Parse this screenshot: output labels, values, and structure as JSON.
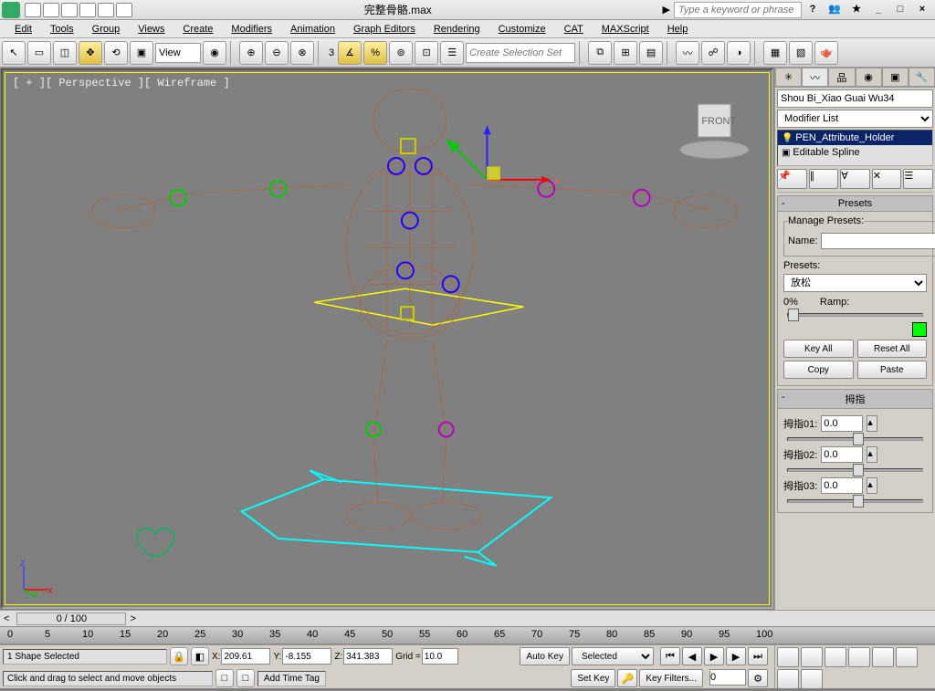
{
  "title": "完整骨骼.max",
  "search_placeholder": "Type a keyword or phrase",
  "menus": [
    "Edit",
    "Tools",
    "Group",
    "Views",
    "Create",
    "Modifiers",
    "Animation",
    "Graph Editors",
    "Rendering",
    "Customize",
    "CAT",
    "MAXScript",
    "Help"
  ],
  "view_label": "View",
  "selection_set_placeholder": "Create Selection Set",
  "viewport_label": "[ + ][ Perspective ][ Wireframe ]",
  "object_name": "Shou Bi_Xiao Guai Wu34",
  "modifier_list_label": "Modifier List",
  "mod_stack": {
    "item1": "PEN_Attribute_Holder",
    "item2": "Editable Spline"
  },
  "presets": {
    "title": "Presets",
    "manage": "Manage Presets:",
    "name_label": "Name:",
    "presets_label": "Presets:",
    "preset_value": "放松",
    "pct": "0%",
    "ramp": "Ramp:",
    "key_all": "Key All",
    "reset_all": "Reset All",
    "copy": "Copy",
    "paste": "Paste"
  },
  "thumb": {
    "title": "拇指",
    "r1": "拇指01:",
    "r2": "拇指02:",
    "r3": "拇指03:",
    "v": "0.0"
  },
  "time": {
    "cur": "0",
    "range": "/ 100"
  },
  "ruler_ticks": [
    "0",
    "5",
    "10",
    "15",
    "20",
    "25",
    "30",
    "35",
    "40",
    "45",
    "50",
    "55",
    "60",
    "65",
    "70",
    "75",
    "80",
    "85",
    "90",
    "95",
    "100"
  ],
  "status": {
    "sel": "1 Shape Selected",
    "hint": "Click and drag to select and move objects"
  },
  "coords": {
    "x": "209.61",
    "y": "-8.155",
    "z": "341.383",
    "grid": "10.0"
  },
  "addtag": "Add Time Tag",
  "keys": {
    "auto": "Auto Key",
    "set": "Set Key",
    "selected": "Selected",
    "filters": "Key Filters..."
  }
}
